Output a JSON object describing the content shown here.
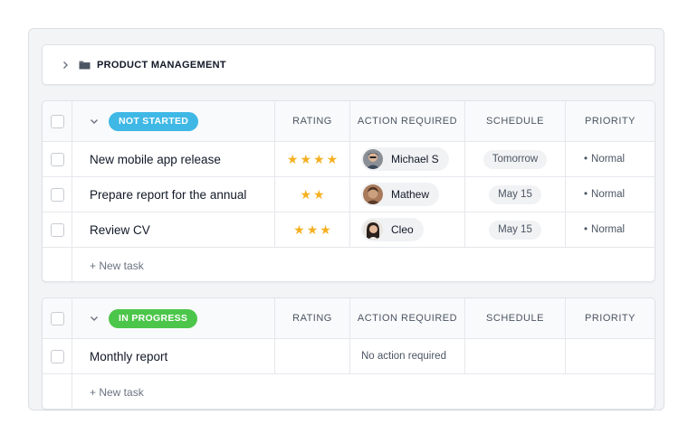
{
  "folder": {
    "title": "PRODUCT MANAGEMENT"
  },
  "columns": {
    "rating": "RATING",
    "action": "ACTION REQUIRED",
    "schedule": "SCHEDULE",
    "priority": "PRIORITY"
  },
  "groups": [
    {
      "status": "NOT STARTED",
      "status_color": "#3fb8e6",
      "tasks": [
        {
          "name": "New mobile app release",
          "rating": 4,
          "assignee": "Michael S",
          "schedule": "Tomorrow",
          "priority": "Normal"
        },
        {
          "name": "Prepare report for the annual",
          "rating": 2,
          "assignee": "Mathew",
          "schedule": "May 15",
          "priority": "Normal"
        },
        {
          "name": "Review CV",
          "rating": 3,
          "assignee": "Cleo",
          "schedule": "May 15",
          "priority": "Normal"
        }
      ],
      "new_task": "+ New task"
    },
    {
      "status": "IN PROGRESS",
      "status_color": "#4cc64a",
      "tasks": [
        {
          "name": "Monthly report",
          "action": "No action required"
        }
      ],
      "new_task": "+ New task"
    }
  ],
  "icons": {
    "star": "star-icon",
    "chevron_right": "chevron-right-icon",
    "chevron_down": "chevron-down-icon",
    "folder": "folder-icon"
  },
  "colors": {
    "star": "#f5b021"
  }
}
